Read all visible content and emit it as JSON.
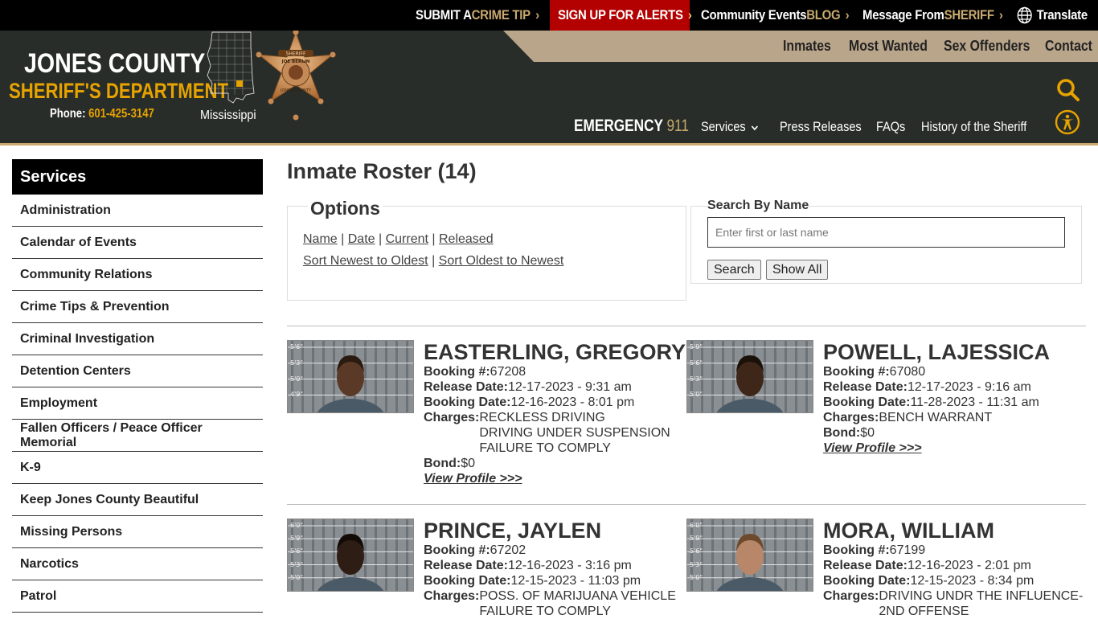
{
  "topbar": {
    "crime_tip_a": "SUBMIT A ",
    "crime_tip_b": "CRIME TIP",
    "alerts": "SIGN UP FOR ALERTS",
    "events_a": "Community Events ",
    "events_b": "BLOG",
    "message_a": "Message From ",
    "message_b": "SHERIFF",
    "translate": "Translate",
    "chevron": "›"
  },
  "header": {
    "line1": "JONES COUNTY",
    "line2": "SHERIFF'S DEPARTMENT",
    "phone_label": "Phone: ",
    "phone": "601-425-3147",
    "state": "Mississippi",
    "badge_text_top": "SHERIFF",
    "badge_text_mid": "JOE BERLIN",
    "badge_text_bot": "JONES COUNTY",
    "secondary_nav": [
      "Inmates",
      "Most Wanted",
      "Sex Offenders",
      "Contact"
    ],
    "emergency_a": "EMERGENCY ",
    "emergency_b": "911",
    "main_nav": [
      "Services",
      "Press Releases",
      "FAQs",
      "History of the Sheriff"
    ],
    "services_caret": "⌵"
  },
  "sidebar": {
    "title": "Services",
    "items": [
      "Administration",
      "Calendar of Events",
      "Community Relations",
      "Crime Tips & Prevention",
      "Criminal Investigation",
      "Detention Centers",
      "Employment",
      "Fallen Officers / Peace Officer Memorial",
      "K-9",
      "Keep Jones County Beautiful",
      "Missing Persons",
      "Narcotics",
      "Patrol"
    ]
  },
  "main": {
    "title": "Inmate Roster (14)",
    "options_title": "Options",
    "sort_links": [
      "Name",
      "Date",
      "Current",
      "Released"
    ],
    "order_links": [
      "Sort Newest to Oldest",
      "Sort Oldest to Newest"
    ],
    "sep": " | ",
    "search_label": "Search By Name",
    "search_placeholder": "Enter first or last name",
    "search_button": "Search",
    "show_all_button": "Show All"
  },
  "labels": {
    "booking_no": "Booking #:",
    "release_date": "Release Date:",
    "booking_date": "Booking Date:",
    "charges": "Charges:",
    "bond": "Bond:",
    "view_profile": "View Profile >>>"
  },
  "inmates": [
    {
      "name": "EASTERLING, GREGORY",
      "booking_no": "67208",
      "release_date": "12-17-2023 - 9:31 am",
      "booking_date": "12-16-2023 - 8:01 pm",
      "charges": [
        "RECKLESS DRIVING",
        "DRIVING UNDER SUSPENSION",
        "FAILURE TO COMPLY"
      ],
      "bond": "$0",
      "height_marks": [
        "5'6\"",
        "5'3\"",
        "5'0\"",
        "4'9\""
      ]
    },
    {
      "name": "POWELL, LAJESSICA",
      "booking_no": "67080",
      "release_date": "12-17-2023 - 9:16 am",
      "booking_date": "11-28-2023 - 11:31 am",
      "charges": [
        "BENCH WARRANT"
      ],
      "bond": "$0",
      "height_marks": [
        "5'9\"",
        "5'6\"",
        "5'3\"",
        "5'0\""
      ]
    },
    {
      "name": "PRINCE, JAYLEN",
      "booking_no": "67202",
      "release_date": "12-16-2023 - 3:16 pm",
      "booking_date": "12-15-2023 - 11:03 pm",
      "charges": [
        "POSS. OF MARIJUANA VEHICLE",
        "FAILURE TO COMPLY"
      ],
      "bond": "",
      "height_marks": [
        "6'0\"",
        "5'9\"",
        "5'6\"",
        "5'3\"",
        "5'0\""
      ]
    },
    {
      "name": "MORA, WILLIAM",
      "booking_no": "67199",
      "release_date": "12-16-2023 - 2:01 pm",
      "booking_date": "12-15-2023 - 8:34 pm",
      "charges": [
        "DRIVING UNDR THE INFLUENCE-",
        "2ND OFFENSE"
      ],
      "bond": "",
      "height_marks": [
        "6'0\"",
        "5'9\"",
        "5'6\"",
        "5'3\"",
        "5'0\""
      ]
    }
  ],
  "colors": {
    "header_bg": "#282d29",
    "gold": "#c9a96e",
    "brand_yellow": "#e6a300",
    "alert_red": "#b30000",
    "tan": "#b9a58a"
  }
}
